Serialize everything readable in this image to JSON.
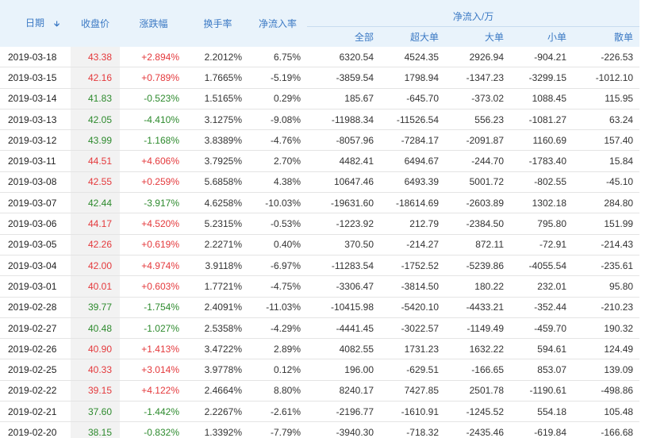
{
  "colors": {
    "header_bg": "#e9f3fb",
    "header_text": "#3b79c4",
    "up": "#e4393c",
    "down": "#2d8a2d"
  },
  "headers": {
    "date": "日期",
    "sort_icon": "arrow-down-icon",
    "close": "收盘价",
    "change": "涨跌幅",
    "turnover": "换手率",
    "net_ratio": "净流入率",
    "net_group": "净流入/万",
    "all": "全部",
    "super_large": "超大单",
    "large": "大单",
    "small": "小单",
    "retail": "散单"
  },
  "rows": [
    {
      "date": "2019-03-18",
      "close": "43.38",
      "change": "+2.894%",
      "turnover": "2.2012%",
      "ratio": "6.75%",
      "all": "6320.54",
      "super": "4524.35",
      "large": "2926.94",
      "small": "-904.21",
      "retail": "-226.53",
      "dir": "up"
    },
    {
      "date": "2019-03-15",
      "close": "42.16",
      "change": "+0.789%",
      "turnover": "1.7665%",
      "ratio": "-5.19%",
      "all": "-3859.54",
      "super": "1798.94",
      "large": "-1347.23",
      "small": "-3299.15",
      "retail": "-1012.10",
      "dir": "up"
    },
    {
      "date": "2019-03-14",
      "close": "41.83",
      "change": "-0.523%",
      "turnover": "1.5165%",
      "ratio": "0.29%",
      "all": "185.67",
      "super": "-645.70",
      "large": "-373.02",
      "small": "1088.45",
      "retail": "115.95",
      "dir": "dn"
    },
    {
      "date": "2019-03-13",
      "close": "42.05",
      "change": "-4.410%",
      "turnover": "3.1275%",
      "ratio": "-9.08%",
      "all": "-11988.34",
      "super": "-11526.54",
      "large": "556.23",
      "small": "-1081.27",
      "retail": "63.24",
      "dir": "dn"
    },
    {
      "date": "2019-03-12",
      "close": "43.99",
      "change": "-1.168%",
      "turnover": "3.8389%",
      "ratio": "-4.76%",
      "all": "-8057.96",
      "super": "-7284.17",
      "large": "-2091.87",
      "small": "1160.69",
      "retail": "157.40",
      "dir": "dn"
    },
    {
      "date": "2019-03-11",
      "close": "44.51",
      "change": "+4.606%",
      "turnover": "3.7925%",
      "ratio": "2.70%",
      "all": "4482.41",
      "super": "6494.67",
      "large": "-244.70",
      "small": "-1783.40",
      "retail": "15.84",
      "dir": "up"
    },
    {
      "date": "2019-03-08",
      "close": "42.55",
      "change": "+0.259%",
      "turnover": "5.6858%",
      "ratio": "4.38%",
      "all": "10647.46",
      "super": "6493.39",
      "large": "5001.72",
      "small": "-802.55",
      "retail": "-45.10",
      "dir": "up"
    },
    {
      "date": "2019-03-07",
      "close": "42.44",
      "change": "-3.917%",
      "turnover": "4.6258%",
      "ratio": "-10.03%",
      "all": "-19631.60",
      "super": "-18614.69",
      "large": "-2603.89",
      "small": "1302.18",
      "retail": "284.80",
      "dir": "dn"
    },
    {
      "date": "2019-03-06",
      "close": "44.17",
      "change": "+4.520%",
      "turnover": "5.2315%",
      "ratio": "-0.53%",
      "all": "-1223.92",
      "super": "212.79",
      "large": "-2384.50",
      "small": "795.80",
      "retail": "151.99",
      "dir": "up"
    },
    {
      "date": "2019-03-05",
      "close": "42.26",
      "change": "+0.619%",
      "turnover": "2.2271%",
      "ratio": "0.40%",
      "all": "370.50",
      "super": "-214.27",
      "large": "872.11",
      "small": "-72.91",
      "retail": "-214.43",
      "dir": "up"
    },
    {
      "date": "2019-03-04",
      "close": "42.00",
      "change": "+4.974%",
      "turnover": "3.9118%",
      "ratio": "-6.97%",
      "all": "-11283.54",
      "super": "-1752.52",
      "large": "-5239.86",
      "small": "-4055.54",
      "retail": "-235.61",
      "dir": "up"
    },
    {
      "date": "2019-03-01",
      "close": "40.01",
      "change": "+0.603%",
      "turnover": "1.7721%",
      "ratio": "-4.75%",
      "all": "-3306.47",
      "super": "-3814.50",
      "large": "180.22",
      "small": "232.01",
      "retail": "95.80",
      "dir": "up"
    },
    {
      "date": "2019-02-28",
      "close": "39.77",
      "change": "-1.754%",
      "turnover": "2.4091%",
      "ratio": "-11.03%",
      "all": "-10415.98",
      "super": "-5420.10",
      "large": "-4433.21",
      "small": "-352.44",
      "retail": "-210.23",
      "dir": "dn"
    },
    {
      "date": "2019-02-27",
      "close": "40.48",
      "change": "-1.027%",
      "turnover": "2.5358%",
      "ratio": "-4.29%",
      "all": "-4441.45",
      "super": "-3022.57",
      "large": "-1149.49",
      "small": "-459.70",
      "retail": "190.32",
      "dir": "dn"
    },
    {
      "date": "2019-02-26",
      "close": "40.90",
      "change": "+1.413%",
      "turnover": "3.4722%",
      "ratio": "2.89%",
      "all": "4082.55",
      "super": "1731.23",
      "large": "1632.22",
      "small": "594.61",
      "retail": "124.49",
      "dir": "up"
    },
    {
      "date": "2019-02-25",
      "close": "40.33",
      "change": "+3.014%",
      "turnover": "3.9778%",
      "ratio": "0.12%",
      "all": "196.00",
      "super": "-629.51",
      "large": "-166.65",
      "small": "853.07",
      "retail": "139.09",
      "dir": "up"
    },
    {
      "date": "2019-02-22",
      "close": "39.15",
      "change": "+4.122%",
      "turnover": "2.4664%",
      "ratio": "8.80%",
      "all": "8240.17",
      "super": "7427.85",
      "large": "2501.78",
      "small": "-1190.61",
      "retail": "-498.86",
      "dir": "up"
    },
    {
      "date": "2019-02-21",
      "close": "37.60",
      "change": "-1.442%",
      "turnover": "2.2267%",
      "ratio": "-2.61%",
      "all": "-2196.77",
      "super": "-1610.91",
      "large": "-1245.52",
      "small": "554.18",
      "retail": "105.48",
      "dir": "dn"
    },
    {
      "date": "2019-02-20",
      "close": "38.15",
      "change": "-0.832%",
      "turnover": "1.3392%",
      "ratio": "-7.79%",
      "all": "-3940.30",
      "super": "-718.32",
      "large": "-2435.46",
      "small": "-619.84",
      "retail": "-166.68",
      "dir": "dn"
    }
  ]
}
